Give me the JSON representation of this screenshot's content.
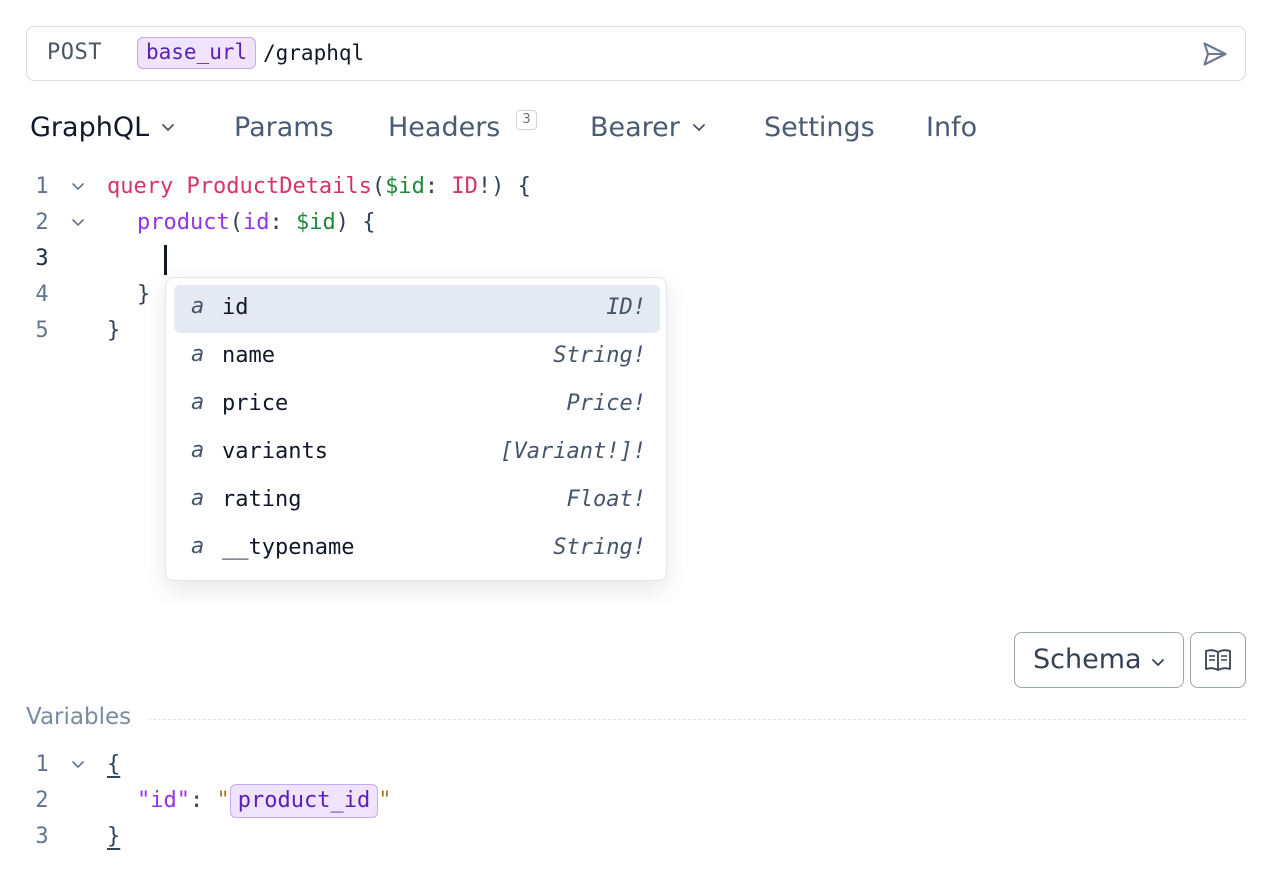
{
  "request": {
    "method": "POST",
    "url_variable": "base_url",
    "url_path": "/graphql"
  },
  "tabs": [
    {
      "label": "GraphQL",
      "active": true,
      "has_dropdown": true
    },
    {
      "label": "Params"
    },
    {
      "label": "Headers",
      "badge": "3"
    },
    {
      "label": "Bearer",
      "has_dropdown": true
    },
    {
      "label": "Settings"
    },
    {
      "label": "Info"
    }
  ],
  "query_editor": {
    "line_numbers": [
      "1",
      "2",
      "3",
      "4",
      "5"
    ],
    "line1": {
      "keyword": "query",
      "name": "ProductDetails",
      "open_paren": "(",
      "variable": "$id",
      "colon": ": ",
      "type": "ID",
      "bang_paren": "!)",
      "brace": " {"
    },
    "line2": {
      "field": "product",
      "open_paren": "(",
      "arg": "id",
      "colon": ": ",
      "variable": "$id",
      "close": ") {"
    },
    "line4": "}",
    "line5": "}"
  },
  "autocomplete": {
    "items": [
      {
        "kind": "a",
        "label": "id",
        "type": "ID!",
        "selected": true
      },
      {
        "kind": "a",
        "label": "name",
        "type": "String!"
      },
      {
        "kind": "a",
        "label": "price",
        "type": "Price!"
      },
      {
        "kind": "a",
        "label": "variants",
        "type": "[Variant!]!"
      },
      {
        "kind": "a",
        "label": "rating",
        "type": "Float!"
      },
      {
        "kind": "a",
        "label": "__typename",
        "type": "String!"
      }
    ]
  },
  "schema_button": {
    "label": "Schema"
  },
  "variables": {
    "section_label": "Variables",
    "line_numbers": [
      "1",
      "2",
      "3"
    ],
    "open_brace": "{",
    "key": "\"id\"",
    "colon": ": ",
    "quote": "\"",
    "value_variable": "product_id",
    "close_brace": "}"
  },
  "colors": {
    "keyword": "#d6336c",
    "variable": "#1e8a3a",
    "field": "#9333ea",
    "string": "#b7791f",
    "template_variable_bg": "#efe3fd"
  },
  "icons": {
    "send": "send-icon",
    "dropdown": "chevron-down-icon",
    "fold": "fold-chevron-icon",
    "docs": "book-icon"
  }
}
